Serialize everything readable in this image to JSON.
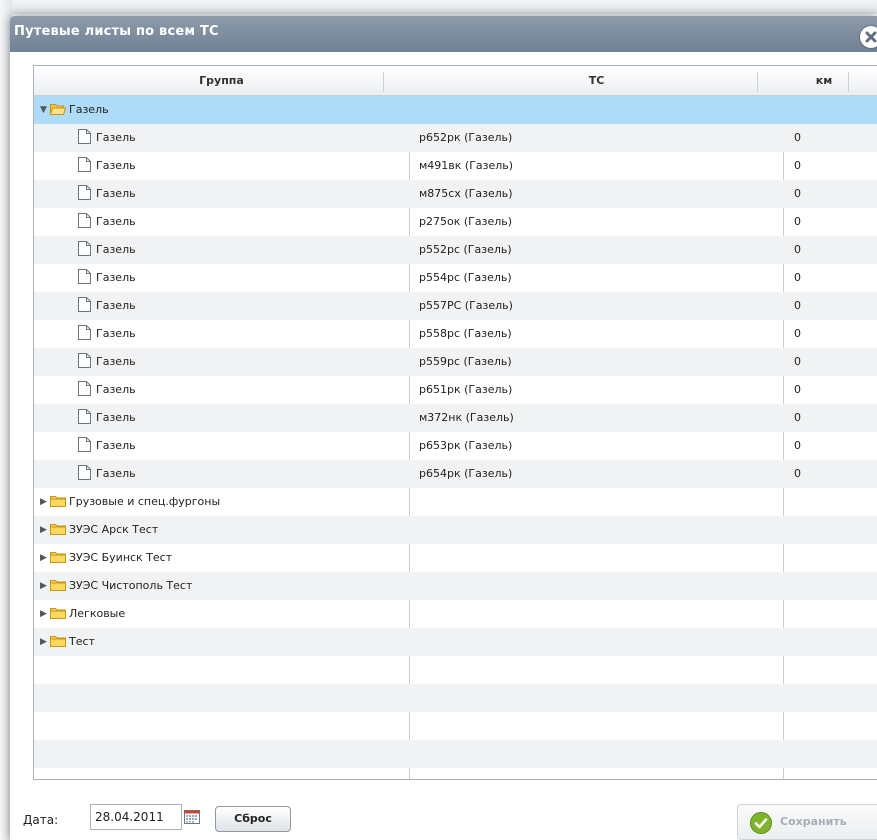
{
  "window": {
    "title": "Путевые листы по всем ТС"
  },
  "grid": {
    "columns": [
      "Группа",
      "ТС",
      "км"
    ],
    "expanded_group": "Газель",
    "children": [
      {
        "group": "Газель",
        "ts": "р652рк (Газель)",
        "km": "0"
      },
      {
        "group": "Газель",
        "ts": "м491вк (Газель)",
        "km": "0"
      },
      {
        "group": "Газель",
        "ts": "м875сх (Газель)",
        "km": "0"
      },
      {
        "group": "Газель",
        "ts": "р275ок (Газель)",
        "km": "0"
      },
      {
        "group": "Газель",
        "ts": "р552рс (Газель)",
        "km": "0"
      },
      {
        "group": "Газель",
        "ts": "р554рс (Газель)",
        "km": "0"
      },
      {
        "group": "Газель",
        "ts": "р557РС (Газель)",
        "km": "0"
      },
      {
        "group": "Газель",
        "ts": "р558рс (Газель)",
        "km": "0"
      },
      {
        "group": "Газель",
        "ts": "р559рс (Газель)",
        "km": "0"
      },
      {
        "group": "Газель",
        "ts": "р651рк (Газель)",
        "km": "0"
      },
      {
        "group": "Газель",
        "ts": "м372нк (Газель)",
        "km": "0"
      },
      {
        "group": "Газель",
        "ts": "р653рк (Газель)",
        "km": "0"
      },
      {
        "group": "Газель",
        "ts": "р654рк (Газель)",
        "km": "0"
      }
    ],
    "collapsed_groups": [
      "Грузовые и спец.фургоны",
      "ЗУЭС Арск Тест",
      "ЗУЭС Буинск Тест",
      "ЗУЭС Чистополь Тест",
      "Легковые",
      "Тест"
    ]
  },
  "footer": {
    "date_label": "Дата:",
    "date_value": "28.04.2011",
    "reset_label": "Сброс",
    "save_label": "Сохранить"
  },
  "colors": {
    "titlebar": "#7d8ea1",
    "selected_row": "#aedbf8",
    "alt_row": "#f1f2f3",
    "save_icon": "#7fb52a"
  },
  "icons": [
    "close-icon",
    "folder-open-icon",
    "folder-icon",
    "file-icon",
    "calendar-icon",
    "check-circle-icon",
    "triangle-down-icon",
    "triangle-right-icon"
  ]
}
